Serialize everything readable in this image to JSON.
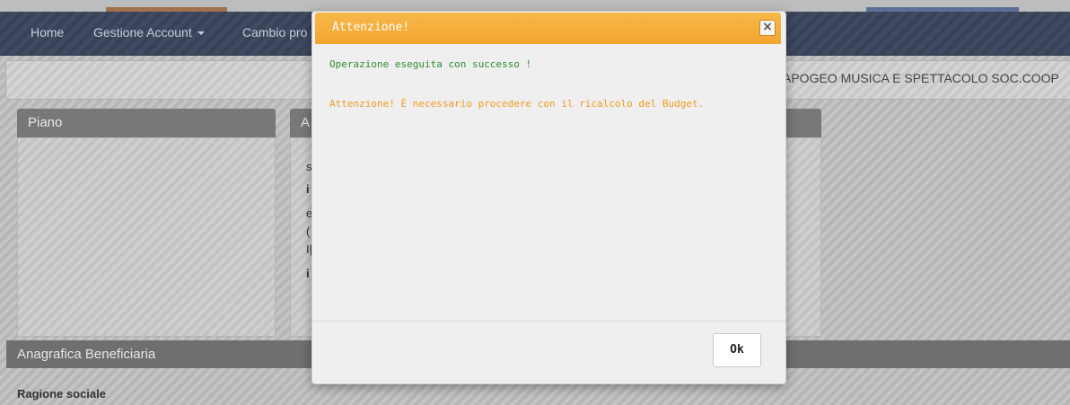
{
  "nav": {
    "items": [
      {
        "label": "Home"
      },
      {
        "label": "Gestione Account"
      },
      {
        "label": "Cambio pro"
      }
    ]
  },
  "infobar": {
    "company": "APOGEO MUSICA E SPETTACOLO SOC.COOP"
  },
  "panels": {
    "piano_title": "Piano",
    "second_title_fragment": "A"
  },
  "fragments": [
    "s",
    "i",
    "e",
    "(",
    "I|",
    "i"
  ],
  "section": {
    "title": "Anagrafica Beneficiaria",
    "field_label": "Ragione sociale"
  },
  "modal": {
    "title": "Attenzione!",
    "close_label": "×",
    "success_message": "Operazione eseguita con successo !",
    "warning_message": "Attenzione! È necessario procedere con il ricalcolo del Budget.",
    "ok_label": "Ok"
  },
  "colors": {
    "modal_header": "#f2a530",
    "success": "#2e8b2e",
    "warning": "#f09a1f",
    "navbar": "#3f4a63"
  }
}
